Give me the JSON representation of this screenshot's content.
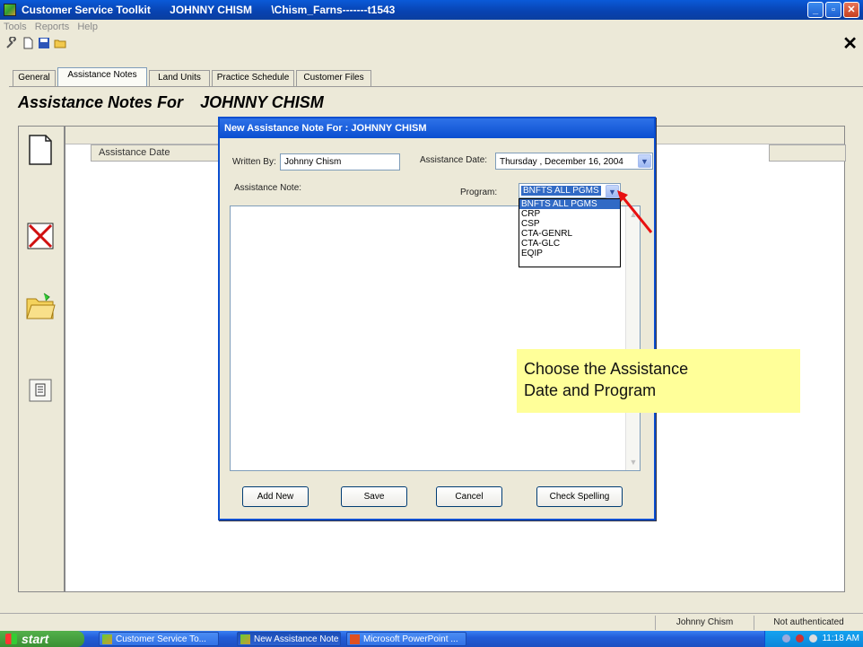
{
  "window": {
    "app_title": "Customer Service Toolkit",
    "customer": "JOHNNY CHISM",
    "path": "\\Chism_Farns-------t1543"
  },
  "menu": [
    "Tools",
    "Reports",
    "Help"
  ],
  "toolbar": {
    "icons": [
      "wrench-icon",
      "new-document-icon",
      "save-icon",
      "open-folder-icon"
    ],
    "close_glyph": "✕"
  },
  "tabs": [
    "General",
    "Assistance Notes",
    "Land Units",
    "Practice Schedule",
    "Customer Files"
  ],
  "active_tab": "Assistance Notes",
  "page": {
    "heading": "Assistance Notes For",
    "heading_name": "JOHNNY CHISM",
    "grid_column": "Assistance Date"
  },
  "dialog": {
    "title": "New Assistance Note For : JOHNNY CHISM",
    "written_by_label": "Written By:",
    "written_by_value": "Johnny Chism",
    "date_label": "Assistance Date:",
    "date_value": "Thursday  , December 16, 2004",
    "note_label": "Assistance Note:",
    "program_label": "Program:",
    "program_value": "BNFTS ALL PGMS",
    "program_options": [
      "BNFTS ALL PGMS",
      "CRP",
      "CSP",
      "CTA-GENRL",
      "CTA-GLC",
      "EQIP"
    ],
    "buttons": {
      "add_new": "Add New",
      "save": "Save",
      "cancel": "Cancel",
      "check_spelling": "Check Spelling"
    }
  },
  "callout": {
    "line1": "Choose the Assistance",
    "line2": "Date and Program"
  },
  "statusbar": {
    "user": "Johnny Chism",
    "auth": "Not authenticated"
  },
  "taskbar": {
    "start": "start",
    "tasks": [
      "Customer Service To...",
      "New Assistance Note ...",
      "Microsoft PowerPoint ..."
    ],
    "clock": "11:18 AM"
  },
  "colors": {
    "title_blue": "#0a4ed0",
    "callout_yellow": "#ffff99",
    "arrow_red": "#e81010",
    "selection_blue": "#316ac5"
  }
}
